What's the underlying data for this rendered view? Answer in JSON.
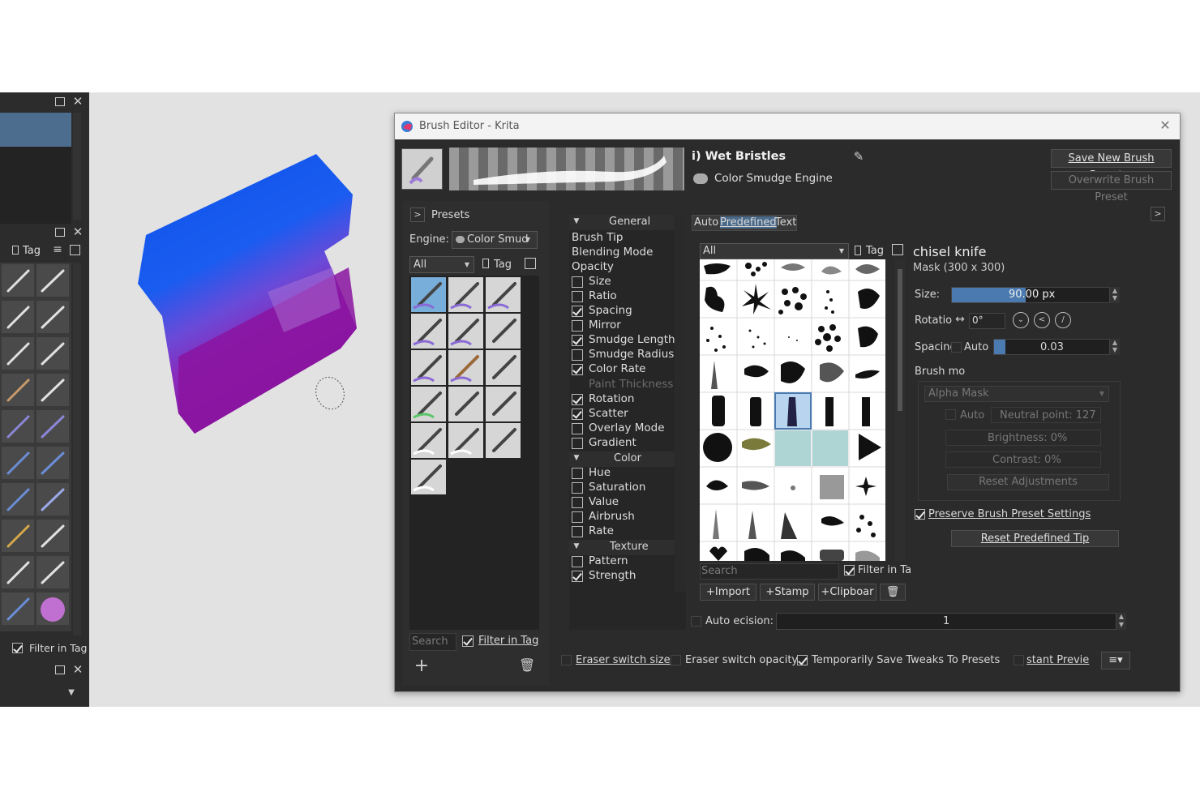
{
  "left_dock": {
    "tag_label": "Tag",
    "filter_in_tag": "Filter in Tag"
  },
  "dialog": {
    "title": "Brush Editor - Krita",
    "preset_name": "i) Wet Bristles",
    "engine_name": "Color Smudge Engine",
    "save_new_preset": "Save New Brush Preset...",
    "overwrite_preset": "Overwrite Brush Preset"
  },
  "presets_panel": {
    "header": "Presets",
    "engine_label": "Engine:",
    "engine_value": "Color Smud",
    "filter_all": "All",
    "tag_label": "Tag",
    "search_placeholder": "Search",
    "filter_in_tag": "Filter in Tag"
  },
  "options": [
    {
      "label": "General",
      "type": "section"
    },
    {
      "label": "Brush Tip",
      "type": "item"
    },
    {
      "label": "Blending Mode",
      "type": "item"
    },
    {
      "label": "Opacity",
      "type": "item"
    },
    {
      "label": "Size",
      "type": "check",
      "checked": false
    },
    {
      "label": "Ratio",
      "type": "check",
      "checked": false
    },
    {
      "label": "Spacing",
      "type": "check",
      "checked": true
    },
    {
      "label": "Mirror",
      "type": "check",
      "checked": false
    },
    {
      "label": "Smudge Length",
      "type": "check",
      "checked": true
    },
    {
      "label": "Smudge Radius",
      "type": "check",
      "checked": false
    },
    {
      "label": "Color Rate",
      "type": "check",
      "checked": true
    },
    {
      "label": "Paint Thickness",
      "type": "disabled"
    },
    {
      "label": "Rotation",
      "type": "check",
      "checked": true
    },
    {
      "label": "Scatter",
      "type": "check",
      "checked": true
    },
    {
      "label": "Overlay Mode",
      "type": "check",
      "checked": false
    },
    {
      "label": "Gradient",
      "type": "check",
      "checked": false
    },
    {
      "label": "Color",
      "type": "section"
    },
    {
      "label": "Hue",
      "type": "check",
      "checked": false
    },
    {
      "label": "Saturation",
      "type": "check",
      "checked": false
    },
    {
      "label": "Value",
      "type": "check",
      "checked": false
    },
    {
      "label": "Airbrush",
      "type": "check",
      "checked": false
    },
    {
      "label": "Rate",
      "type": "check",
      "checked": false
    },
    {
      "label": "Texture",
      "type": "section"
    },
    {
      "label": "Pattern",
      "type": "check",
      "checked": false
    },
    {
      "label": "Strength",
      "type": "check",
      "checked": true
    }
  ],
  "tip_tabs": {
    "auto": "Auto",
    "predefined": "Predefined",
    "text": "Text"
  },
  "tip_browser": {
    "filter_all": "All",
    "tag_label": "Tag",
    "search_placeholder": "Search",
    "filter_in_tag": "Filter in Ta",
    "import": "Import",
    "stamp": "Stamp",
    "clipboard": "Clipboar"
  },
  "tip_props": {
    "name": "chisel knife",
    "mask_info": "Mask (300 x 300)",
    "size_label": "Size:",
    "size_value": "90.00 px",
    "size_fill": 0.47,
    "rotation_label": "Rotatio",
    "rotation_value": "0°",
    "spacing_label": "Spacing",
    "spacing_auto": "Auto",
    "spacing_value": "0.03",
    "brush_mode_label": "Brush mo",
    "brush_mode_value": "Alpha Mask",
    "auto_label": "Auto",
    "neutral_point": "Neutral point: 127",
    "brightness": "Brightness: 0%",
    "contrast": "Contrast: 0%",
    "reset_adjustments": "Reset Adjustments",
    "preserve_settings": "Preserve Brush Preset Settings",
    "reset_predefined_tip": "Reset Predefined Tip"
  },
  "precision": {
    "label": "Auto ecision:",
    "value": "1"
  },
  "footer": {
    "eraser_size": "Eraser switch size",
    "eraser_opacity": "Eraser switch opacity",
    "temp_save": "Temporarily Save Tweaks To Presets",
    "instant_preview": "stant Previe"
  },
  "colors": {
    "accent": "#4a7ab0",
    "panel": "#2b2b2b",
    "title_bar": "#f3f3f3"
  }
}
